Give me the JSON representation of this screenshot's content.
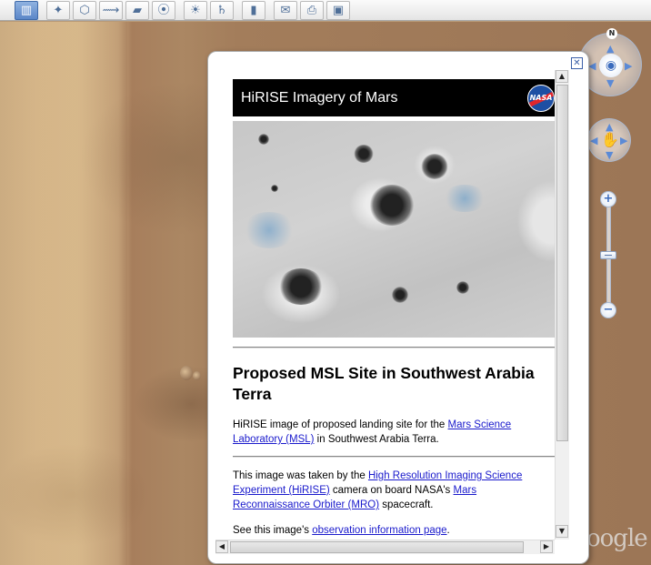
{
  "toolbar": {
    "buttons": [
      {
        "name": "sidebar-toggle-button",
        "icon": "sidebar-icon",
        "glyph": "▥",
        "active": true
      },
      {
        "name": "add-placemark-button",
        "icon": "pushpin-icon",
        "glyph": "✦"
      },
      {
        "name": "add-polygon-button",
        "icon": "polygon-icon",
        "glyph": "⬡"
      },
      {
        "name": "add-path-button",
        "icon": "path-icon",
        "glyph": "⟿"
      },
      {
        "name": "add-image-overlay-button",
        "icon": "image-overlay-icon",
        "glyph": "▰"
      },
      {
        "name": "record-tour-button",
        "icon": "record-tour-icon",
        "glyph": "⦿"
      },
      {
        "name": "historical-imagery-button",
        "icon": "sunlight-icon",
        "glyph": "☀"
      },
      {
        "name": "switch-planet-button",
        "icon": "planet-icon",
        "glyph": "♄"
      },
      {
        "name": "ruler-button",
        "icon": "ruler-icon",
        "glyph": "▮"
      },
      {
        "name": "email-button",
        "icon": "email-icon",
        "glyph": "✉"
      },
      {
        "name": "print-button",
        "icon": "print-icon",
        "glyph": "⎙"
      },
      {
        "name": "view-in-maps-button",
        "icon": "maps-icon",
        "glyph": "▣"
      }
    ]
  },
  "nav": {
    "north_label": "N",
    "zoom_in": "+",
    "zoom_out": "−",
    "zoom_level": 0.5
  },
  "map": {
    "watermark": "oogle"
  },
  "balloon": {
    "close_glyph": "✕",
    "header_title": "HiRISE Imagery of Mars",
    "logo_text": "NASA",
    "site_title": "Proposed MSL Site in Southwest Arabia Terra",
    "para1": {
      "prefix": "HiRISE image of proposed landing site for the ",
      "link": "Mars Science Laboratory (MSL)",
      "suffix": " in Southwest Arabia Terra."
    },
    "para2": {
      "prefix": "This image was taken by the ",
      "link1": "High Resolution Imaging Science Experiment (HiRISE)",
      "middle": " camera on board NASA's ",
      "link2": "Mars Reconnaissance Orbiter (MRO)",
      "suffix": " spacecraft."
    },
    "para3": {
      "prefix": "See this image's ",
      "link": "observation information page",
      "suffix": "."
    }
  },
  "scrollbars": {
    "up": "▲",
    "down": "▼",
    "left": "◀",
    "right": "▶"
  }
}
